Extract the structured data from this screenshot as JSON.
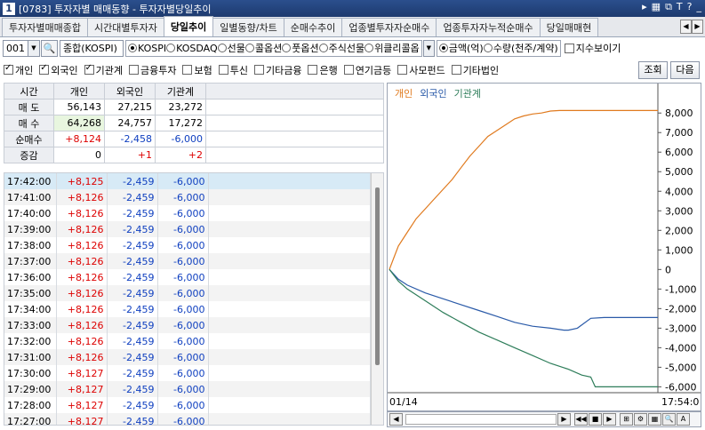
{
  "window": {
    "title": "[0783] 투자자별 매매동향 - 투자자별당일추이",
    "app_icon": "1"
  },
  "tabs": [
    "투자자별매매종합",
    "시간대별투자자",
    "당일추이",
    "일별동향/차트",
    "순매수추이",
    "업종별투자자순매수",
    "업종투자자누적순매수",
    "당일매매현"
  ],
  "active_tab": 2,
  "controls": {
    "code": "001",
    "market": "종합(KOSPI)",
    "radios1": [
      "KOSPI",
      "KOSDAQ",
      "선물",
      "콜옵션",
      "풋옵션",
      "주식선물",
      "위클리콜옵"
    ],
    "radios1_selected": 0,
    "radios2": [
      "금액(억)",
      "수량(천주/계약)"
    ],
    "radios2_selected": 0,
    "index_toggle": "지수보이기",
    "investors": [
      {
        "label": "개인",
        "checked": true
      },
      {
        "label": "외국인",
        "checked": true
      },
      {
        "label": "기관계",
        "checked": true
      },
      {
        "label": "금융투자",
        "checked": false
      },
      {
        "label": "보험",
        "checked": false
      },
      {
        "label": "투신",
        "checked": false
      },
      {
        "label": "기타금융",
        "checked": false
      },
      {
        "label": "은행",
        "checked": false
      },
      {
        "label": "연기금등",
        "checked": false
      },
      {
        "label": "사모펀드",
        "checked": false
      },
      {
        "label": "기타법인",
        "checked": false
      }
    ],
    "query_btn": "조회",
    "next_btn": "다음"
  },
  "summary": {
    "headers": [
      "시간",
      "개인",
      "외국인",
      "기관계"
    ],
    "rows": [
      {
        "label": "매 도",
        "v": [
          "56,143",
          "27,215",
          "23,272"
        ]
      },
      {
        "label": "매 수",
        "v": [
          "64,268",
          "24,757",
          "17,272"
        ]
      },
      {
        "label": "순매수",
        "v": [
          "+8,124",
          "-2,458",
          "-6,000"
        ]
      },
      {
        "label": "증감",
        "v": [
          "0",
          "+1",
          "+2"
        ]
      }
    ]
  },
  "list": [
    [
      "17:42:00",
      "+8,125",
      "-2,459",
      "-6,000"
    ],
    [
      "17:41:00",
      "+8,126",
      "-2,459",
      "-6,000"
    ],
    [
      "17:40:00",
      "+8,126",
      "-2,459",
      "-6,000"
    ],
    [
      "17:39:00",
      "+8,126",
      "-2,459",
      "-6,000"
    ],
    [
      "17:38:00",
      "+8,126",
      "-2,459",
      "-6,000"
    ],
    [
      "17:37:00",
      "+8,126",
      "-2,459",
      "-6,000"
    ],
    [
      "17:36:00",
      "+8,126",
      "-2,459",
      "-6,000"
    ],
    [
      "17:35:00",
      "+8,126",
      "-2,459",
      "-6,000"
    ],
    [
      "17:34:00",
      "+8,126",
      "-2,459",
      "-6,000"
    ],
    [
      "17:33:00",
      "+8,126",
      "-2,459",
      "-6,000"
    ],
    [
      "17:32:00",
      "+8,126",
      "-2,459",
      "-6,000"
    ],
    [
      "17:31:00",
      "+8,126",
      "-2,459",
      "-6,000"
    ],
    [
      "17:30:00",
      "+8,127",
      "-2,459",
      "-6,000"
    ],
    [
      "17:29:00",
      "+8,127",
      "-2,459",
      "-6,000"
    ],
    [
      "17:28:00",
      "+8,127",
      "-2,459",
      "-6,000"
    ],
    [
      "17:27:00",
      "+8,127",
      "-2,459",
      "-6,000"
    ]
  ],
  "chart_data": {
    "type": "line",
    "legend": [
      "개인",
      "외국인",
      "기관계"
    ],
    "y_ticks": [
      "8,000",
      "7,000",
      "6,000",
      "5,000",
      "4,000",
      "3,000",
      "2,000",
      "1,000",
      "0",
      "-1,000",
      "-2,000",
      "-3,000",
      "-4,000",
      "-5,000",
      "-6,000"
    ],
    "ylim": [
      -6300,
      8600
    ],
    "x_start": "01/14",
    "x_end": "17:54:0",
    "colors": {
      "개인": "#e07a1e",
      "외국인": "#2a5aa8",
      "기관계": "#2e7d5a"
    },
    "series": [
      {
        "name": "개인",
        "points": [
          [
            0,
            0
          ],
          [
            5,
            600
          ],
          [
            10,
            1200
          ],
          [
            20,
            1900
          ],
          [
            30,
            2600
          ],
          [
            40,
            3100
          ],
          [
            50,
            3600
          ],
          [
            60,
            4100
          ],
          [
            70,
            4600
          ],
          [
            80,
            5200
          ],
          [
            90,
            5800
          ],
          [
            100,
            6300
          ],
          [
            110,
            6800
          ],
          [
            120,
            7100
          ],
          [
            130,
            7400
          ],
          [
            140,
            7700
          ],
          [
            150,
            7850
          ],
          [
            160,
            7950
          ],
          [
            170,
            8000
          ],
          [
            180,
            8100
          ],
          [
            190,
            8126
          ],
          [
            200,
            8126
          ],
          [
            225,
            8126
          ],
          [
            300,
            8126
          ]
        ]
      },
      {
        "name": "외국인",
        "points": [
          [
            0,
            0
          ],
          [
            10,
            -500
          ],
          [
            20,
            -800
          ],
          [
            40,
            -1200
          ],
          [
            60,
            -1500
          ],
          [
            80,
            -1800
          ],
          [
            100,
            -2100
          ],
          [
            120,
            -2400
          ],
          [
            140,
            -2700
          ],
          [
            160,
            -2900
          ],
          [
            180,
            -3000
          ],
          [
            195,
            -3100
          ],
          [
            200,
            -3100
          ],
          [
            210,
            -3000
          ],
          [
            225,
            -2500
          ],
          [
            240,
            -2459
          ],
          [
            260,
            -2459
          ],
          [
            300,
            -2459
          ]
        ]
      },
      {
        "name": "기관계",
        "points": [
          [
            0,
            0
          ],
          [
            10,
            -600
          ],
          [
            20,
            -1000
          ],
          [
            40,
            -1600
          ],
          [
            60,
            -2200
          ],
          [
            80,
            -2700
          ],
          [
            100,
            -3200
          ],
          [
            120,
            -3600
          ],
          [
            140,
            -4000
          ],
          [
            160,
            -4400
          ],
          [
            180,
            -4800
          ],
          [
            200,
            -5100
          ],
          [
            215,
            -5400
          ],
          [
            225,
            -5500
          ],
          [
            230,
            -6000
          ],
          [
            260,
            -6000
          ],
          [
            300,
            -6000
          ]
        ]
      }
    ]
  }
}
